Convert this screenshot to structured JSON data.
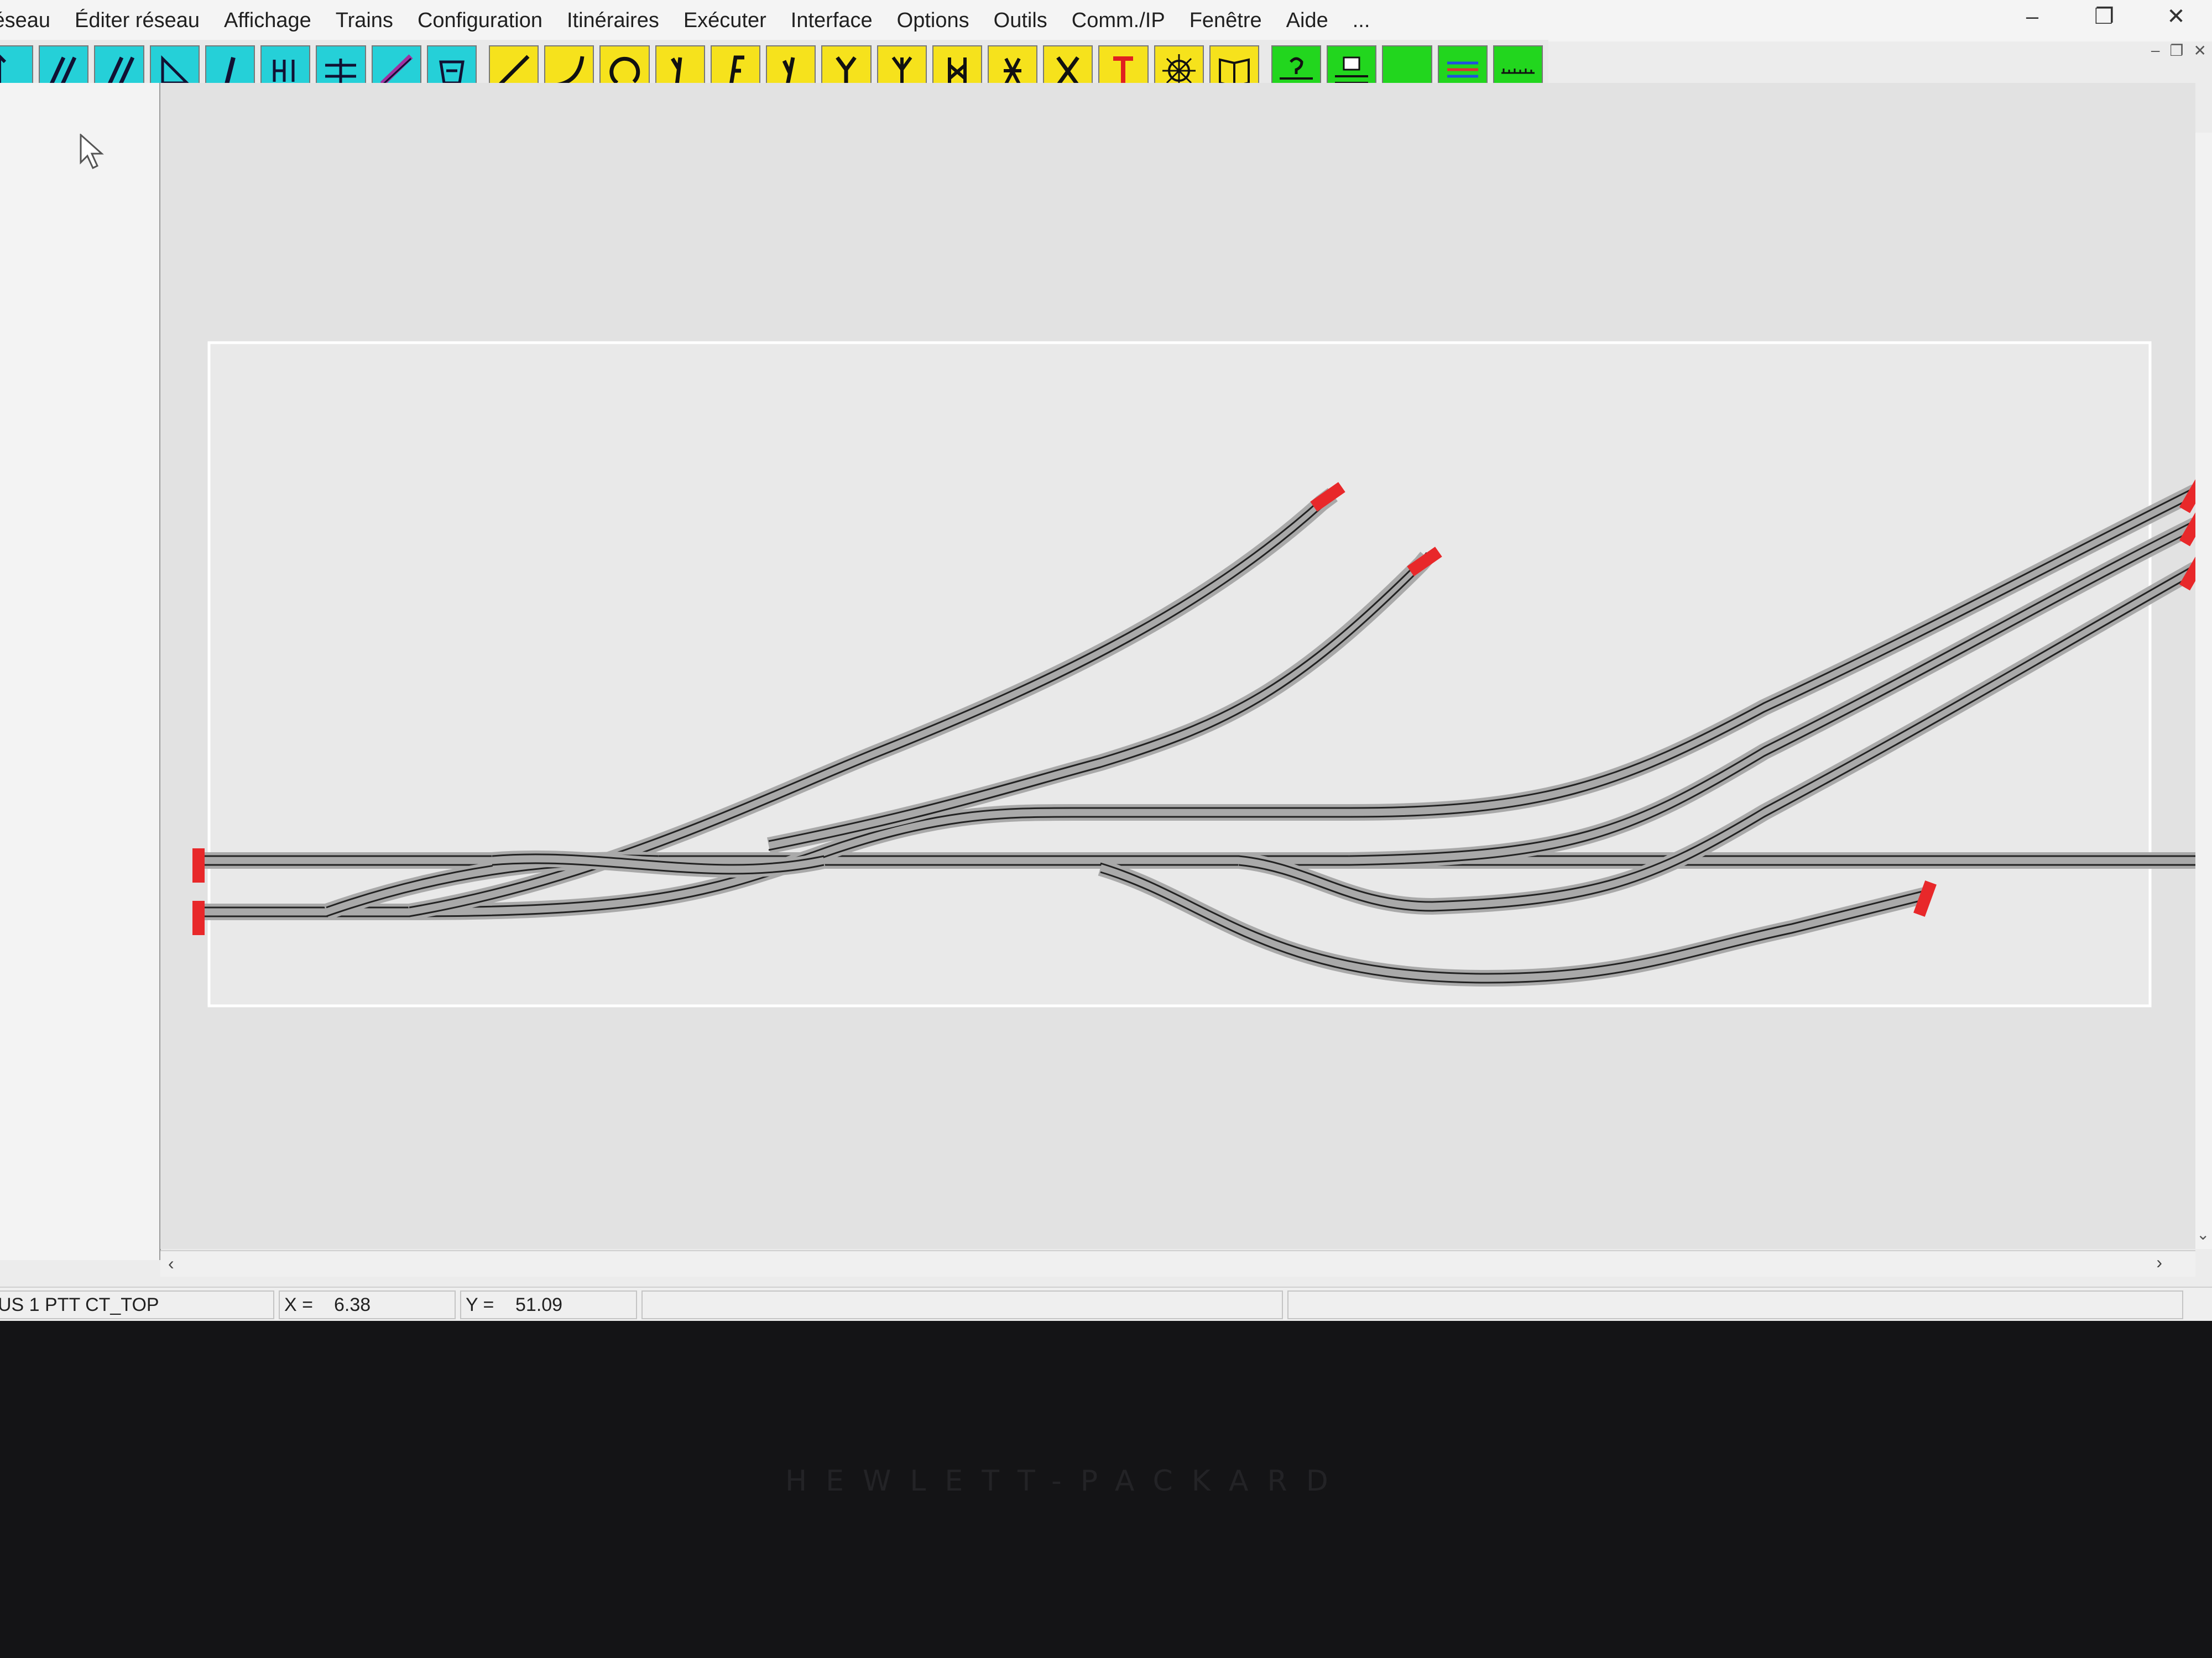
{
  "menu": {
    "items": [
      {
        "key": "reseau",
        "label": "Réseau"
      },
      {
        "key": "editer",
        "label": "Éditer réseau"
      },
      {
        "key": "affichage",
        "label": "Affichage"
      },
      {
        "key": "trains",
        "label": "Trains"
      },
      {
        "key": "configuration",
        "label": "Configuration"
      },
      {
        "key": "itineraires",
        "label": "Itinéraires"
      },
      {
        "key": "executer",
        "label": "Exécuter"
      },
      {
        "key": "interface",
        "label": "Interface"
      },
      {
        "key": "options",
        "label": "Options"
      },
      {
        "key": "outils",
        "label": "Outils"
      },
      {
        "key": "comm",
        "label": "Comm./IP"
      },
      {
        "key": "fenetre",
        "label": "Fenêtre"
      },
      {
        "key": "aide",
        "label": "Aide"
      },
      {
        "key": "more",
        "label": "..."
      }
    ]
  },
  "window_controls": {
    "minimize": "–",
    "restore": "❐",
    "close": "✕"
  },
  "mdi_controls": {
    "minimize": "–",
    "restore": "❐",
    "close": "✕"
  },
  "toolbar": {
    "buttons": [
      {
        "name": "select-tool",
        "color": "cyan",
        "glyph": "pointer"
      },
      {
        "name": "double-track-tool",
        "color": "cyan",
        "glyph": "double"
      },
      {
        "name": "parallel-track-tool",
        "color": "cyan",
        "glyph": "double2"
      },
      {
        "name": "polygon-tool",
        "color": "cyan",
        "glyph": "poly"
      },
      {
        "name": "single-line-tool",
        "color": "cyan",
        "glyph": "slash"
      },
      {
        "name": "signal-tool",
        "color": "cyan",
        "glyph": "hi"
      },
      {
        "name": "bridge-tool",
        "color": "cyan",
        "glyph": "bridge"
      },
      {
        "name": "diagonal-tool",
        "color": "cyan",
        "glyph": "diag"
      },
      {
        "name": "turntable-tool",
        "color": "cyan",
        "glyph": "cup"
      },
      {
        "name": "straight-track-tool",
        "color": "yellow",
        "glyph": "line"
      },
      {
        "name": "curve-track-tool",
        "color": "yellow",
        "glyph": "curve"
      },
      {
        "name": "loop-track-tool",
        "color": "yellow",
        "glyph": "loop"
      },
      {
        "name": "left-turnout-tool",
        "color": "yellow",
        "glyph": "y1"
      },
      {
        "name": "right-turnout-tool",
        "color": "yellow",
        "glyph": "f"
      },
      {
        "name": "curved-turnout-tool",
        "color": "yellow",
        "glyph": "y2"
      },
      {
        "name": "wye-turnout-tool",
        "color": "yellow",
        "glyph": "y"
      },
      {
        "name": "three-way-turnout-tool",
        "color": "yellow",
        "glyph": "w"
      },
      {
        "name": "double-slip-tool",
        "color": "yellow",
        "glyph": "slip"
      },
      {
        "name": "single-slip-tool",
        "color": "yellow",
        "glyph": "slip2"
      },
      {
        "name": "crossing-tool",
        "color": "yellow",
        "glyph": "x"
      },
      {
        "name": "track-end-tool",
        "color": "yellow",
        "glyph": "t"
      },
      {
        "name": "turntable-yard-tool",
        "color": "yellow",
        "glyph": "star"
      },
      {
        "name": "book-tool",
        "color": "yellow",
        "glyph": "book"
      },
      {
        "name": "help-signal-tool",
        "color": "green",
        "glyph": "q"
      },
      {
        "name": "block-tool",
        "color": "green",
        "glyph": "block"
      },
      {
        "name": "green-panel-tool",
        "color": "green",
        "glyph": "none"
      },
      {
        "name": "layers-tool",
        "color": "green",
        "glyph": "layers"
      },
      {
        "name": "ruler-tool",
        "color": "green",
        "glyph": "ruler"
      }
    ]
  },
  "layout": {
    "title": "US 1 PTT CT_TOP"
  },
  "status": {
    "layout_name": "US 1 PTT CT_TOP",
    "x_label": "X =",
    "x_value": "6.38",
    "y_label": "Y =",
    "y_value": "51.09",
    "empty_cell_1": "",
    "empty_cell_2": ""
  },
  "colors": {
    "track_bed": "#a9a9a9",
    "rail": "#222222",
    "bumper": "#e8282a",
    "tool_cyan": "#25d0d8",
    "tool_yellow": "#f6e21c",
    "tool_green": "#22d61e"
  },
  "bezel": {
    "brand": "HEWLETT-PACKARD"
  }
}
